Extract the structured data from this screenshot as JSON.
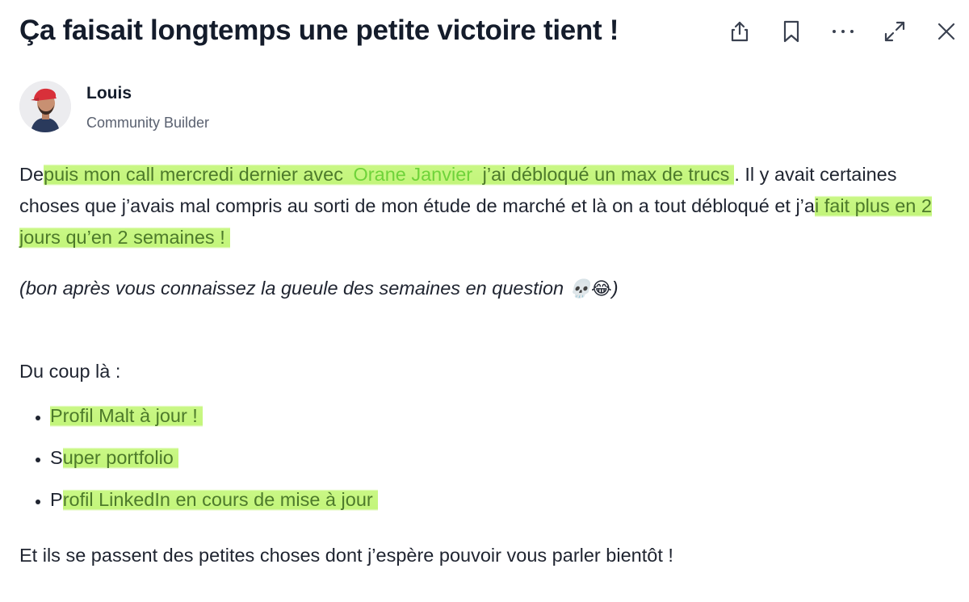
{
  "post": {
    "title": "Ça faisait longtemps une petite victoire tient !",
    "author": {
      "name": "Louis",
      "role": "Community Builder"
    },
    "para1": {
      "pre": "De",
      "hl1": "puis mon call mercredi dernier avec ",
      "mention": "Orane Janvier",
      "hl2": " j’ai débloqué un max de trucs",
      "mid": ". Il y avait certaines choses que j’avais mal compris au sorti de mon étude de marché et là on a tout débloqué et j’a",
      "hl3": "i fait plus en 2 jours qu’en 2 semaines !"
    },
    "aside": {
      "text": "(bon après vous connaissez la gueule des semaines en question ",
      "emoji": "💀😂",
      "close": ")"
    },
    "intro": "Du coup là :",
    "list": [
      {
        "pre": "",
        "hl": "Profil Malt à jour !"
      },
      {
        "pre": "S",
        "hl": "uper portfolio"
      },
      {
        "pre": "P",
        "hl": "rofil LinkedIn en cours de mise à jour"
      }
    ],
    "closing": "Et ils se passent des petites choses dont j’espère pouvoir vous parler bientôt !"
  },
  "toolbar": [
    "share-icon",
    "bookmark-icon",
    "more-icon",
    "expand-icon",
    "close-icon"
  ],
  "colors": {
    "highlight": "#c0f670",
    "mention": "#6fd33a",
    "title": "#141c2b"
  }
}
